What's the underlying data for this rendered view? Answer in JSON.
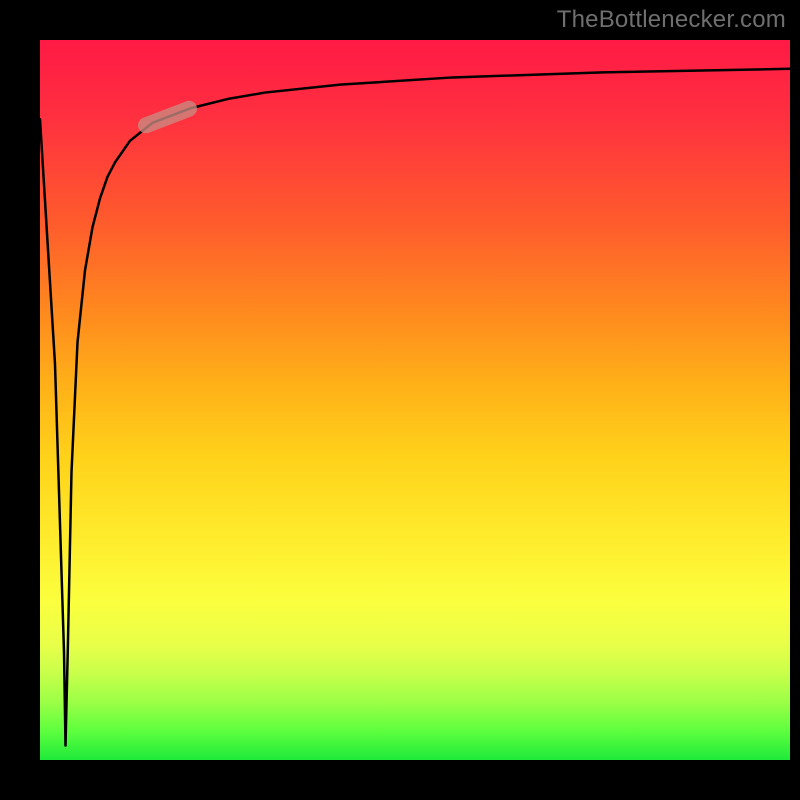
{
  "brand": {
    "watermark_text": "TheBottlenecker.com"
  },
  "chart_data": {
    "type": "line",
    "title": "",
    "xlabel": "",
    "ylabel": "",
    "xlim": [
      0,
      100
    ],
    "ylim": [
      0,
      100
    ],
    "legend": false,
    "grid": false,
    "background": "vertical-gradient:red-orange-yellow-green",
    "axes_visible": false,
    "series": [
      {
        "name": "bottleneck-curve",
        "color": "#000000",
        "x": [
          0.0,
          2.0,
          3.2,
          3.4,
          3.7,
          4.2,
          5.0,
          6.0,
          7.0,
          8.0,
          9.0,
          10.0,
          12.0,
          15.0,
          20.0,
          25.0,
          30.0,
          40.0,
          55.0,
          75.0,
          100.0
        ],
        "y": [
          89.0,
          55.0,
          15.0,
          2.0,
          15.0,
          40.0,
          58.0,
          68.0,
          74.0,
          78.0,
          81.0,
          83.0,
          86.0,
          88.5,
          90.5,
          91.8,
          92.7,
          93.8,
          94.8,
          95.5,
          96.0
        ]
      }
    ],
    "marker": {
      "description": "highlight capsule on curve",
      "approx_x": 17.0,
      "approx_y": 89.6,
      "color": "#c98b82",
      "opacity": 0.78
    }
  }
}
